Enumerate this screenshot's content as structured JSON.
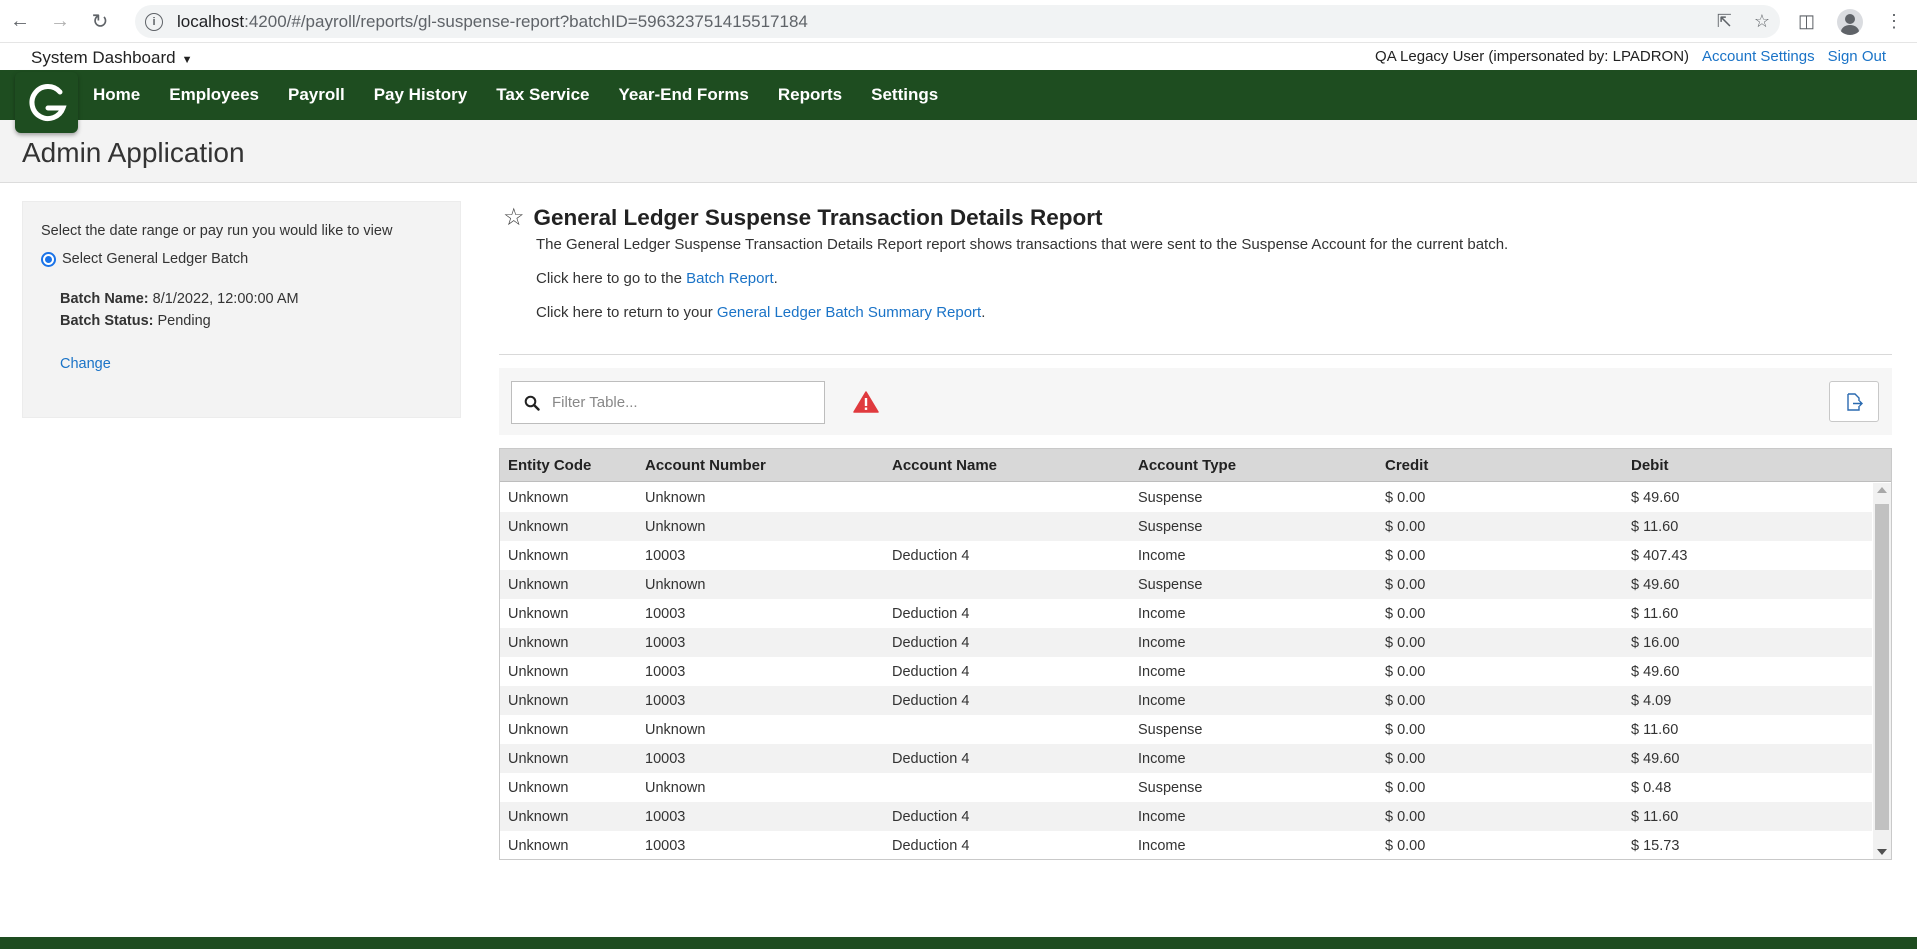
{
  "browser": {
    "url_host": "localhost",
    "url_rest": ":4200/#/payroll/reports/gl-suspense-report?batchID=596323751415517184"
  },
  "topbar": {
    "system_dashboard": "System Dashboard",
    "user_label": "QA Legacy User (impersonated by: LPADRON)",
    "account_settings": "Account Settings",
    "sign_out": "Sign Out"
  },
  "nav": {
    "items": [
      "Home",
      "Employees",
      "Payroll",
      "Pay History",
      "Tax Service",
      "Year-End Forms",
      "Reports",
      "Settings"
    ]
  },
  "page": {
    "title": "Admin Application"
  },
  "left_panel": {
    "prompt": "Select the date range or pay run you would like to view",
    "radio_label": "Select General Ledger Batch",
    "batch_name_label": "Batch Name:",
    "batch_name_value": "8/1/2022, 12:00:00 AM",
    "batch_status_label": "Batch Status:",
    "batch_status_value": "Pending",
    "change_link": "Change"
  },
  "report": {
    "title": "General Ledger Suspense Transaction Details Report",
    "description": "The General Ledger Suspense Transaction Details Report report shows transactions that were sent to the Suspense Account for the current batch.",
    "batch_line_prefix": "Click here to go to the ",
    "batch_link": "Batch Report",
    "summary_line_prefix": "Click here to return to your ",
    "summary_link": "General Ledger Batch Summary Report",
    "period": "."
  },
  "toolbar": {
    "filter_placeholder": "Filter Table..."
  },
  "table": {
    "columns": [
      "Entity Code",
      "Account Number",
      "Account Name",
      "Account Type",
      "Credit",
      "Debit"
    ],
    "rows": [
      [
        "Unknown",
        "Unknown",
        "",
        "Suspense",
        "$ 0.00",
        "$ 49.60"
      ],
      [
        "Unknown",
        "Unknown",
        "",
        "Suspense",
        "$ 0.00",
        "$ 11.60"
      ],
      [
        "Unknown",
        "10003",
        "Deduction 4",
        "Income",
        "$ 0.00",
        "$ 407.43"
      ],
      [
        "Unknown",
        "Unknown",
        "",
        "Suspense",
        "$ 0.00",
        "$ 49.60"
      ],
      [
        "Unknown",
        "10003",
        "Deduction 4",
        "Income",
        "$ 0.00",
        "$ 11.60"
      ],
      [
        "Unknown",
        "10003",
        "Deduction 4",
        "Income",
        "$ 0.00",
        "$ 16.00"
      ],
      [
        "Unknown",
        "10003",
        "Deduction 4",
        "Income",
        "$ 0.00",
        "$ 49.60"
      ],
      [
        "Unknown",
        "10003",
        "Deduction 4",
        "Income",
        "$ 0.00",
        "$ 4.09"
      ],
      [
        "Unknown",
        "Unknown",
        "",
        "Suspense",
        "$ 0.00",
        "$ 11.60"
      ],
      [
        "Unknown",
        "10003",
        "Deduction 4",
        "Income",
        "$ 0.00",
        "$ 49.60"
      ],
      [
        "Unknown",
        "Unknown",
        "",
        "Suspense",
        "$ 0.00",
        "$ 0.48"
      ],
      [
        "Unknown",
        "10003",
        "Deduction 4",
        "Income",
        "$ 0.00",
        "$ 11.60"
      ],
      [
        "Unknown",
        "10003",
        "Deduction 4",
        "Income",
        "$ 0.00",
        "$ 15.73"
      ]
    ]
  },
  "colors": {
    "nav_green": "#1e4d20",
    "link_blue": "#1a73c7",
    "warning_red": "#e03a3e"
  }
}
